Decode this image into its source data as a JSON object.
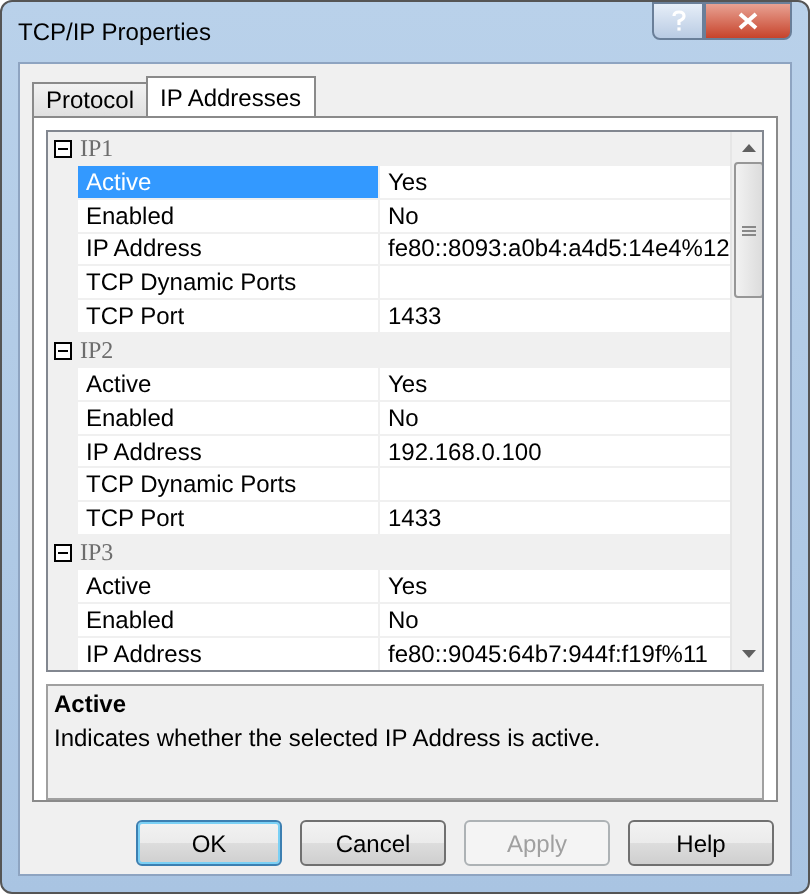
{
  "window": {
    "title": "TCP/IP Properties"
  },
  "tabs": [
    {
      "label": "Protocol",
      "selected": false
    },
    {
      "label": "IP Addresses",
      "selected": true
    }
  ],
  "groups": [
    {
      "name": "IP1",
      "expanded": true,
      "properties": [
        {
          "name": "Active",
          "value": "Yes",
          "selected": true
        },
        {
          "name": "Enabled",
          "value": "No",
          "selected": false
        },
        {
          "name": "IP Address",
          "value": "fe80::8093:a0b4:a4d5:14e4%12",
          "selected": false
        },
        {
          "name": "TCP Dynamic Ports",
          "selected": false
        },
        {
          "name": "TCP Port",
          "value": "1433",
          "selected": false
        }
      ]
    },
    {
      "name": "IP2",
      "expanded": true,
      "properties": [
        {
          "name": "Active",
          "value": "Yes",
          "selected": false
        },
        {
          "name": "Enabled",
          "value": "No",
          "selected": false
        },
        {
          "name": "IP Address",
          "value": "192.168.0.100",
          "selected": false
        },
        {
          "name": "TCP Dynamic Ports",
          "selected": false
        },
        {
          "name": "TCP Port",
          "value": "1433",
          "selected": false
        }
      ]
    },
    {
      "name": "IP3",
      "expanded": true,
      "properties": [
        {
          "name": "Active",
          "value": "Yes",
          "selected": false
        },
        {
          "name": "Enabled",
          "value": "No",
          "selected": false
        },
        {
          "name": "IP Address",
          "value": "fe80::9045:64b7:944f:f19f%11",
          "selected": false
        }
      ]
    }
  ],
  "description": {
    "title": "Active",
    "text": "Indicates whether the selected IP Address is active."
  },
  "buttons": [
    {
      "label": "OK",
      "default": true,
      "disabled": false
    },
    {
      "label": "Cancel",
      "default": false,
      "disabled": false
    },
    {
      "label": "Apply",
      "default": false,
      "disabled": true
    },
    {
      "label": "Help",
      "default": false,
      "disabled": false
    }
  ]
}
